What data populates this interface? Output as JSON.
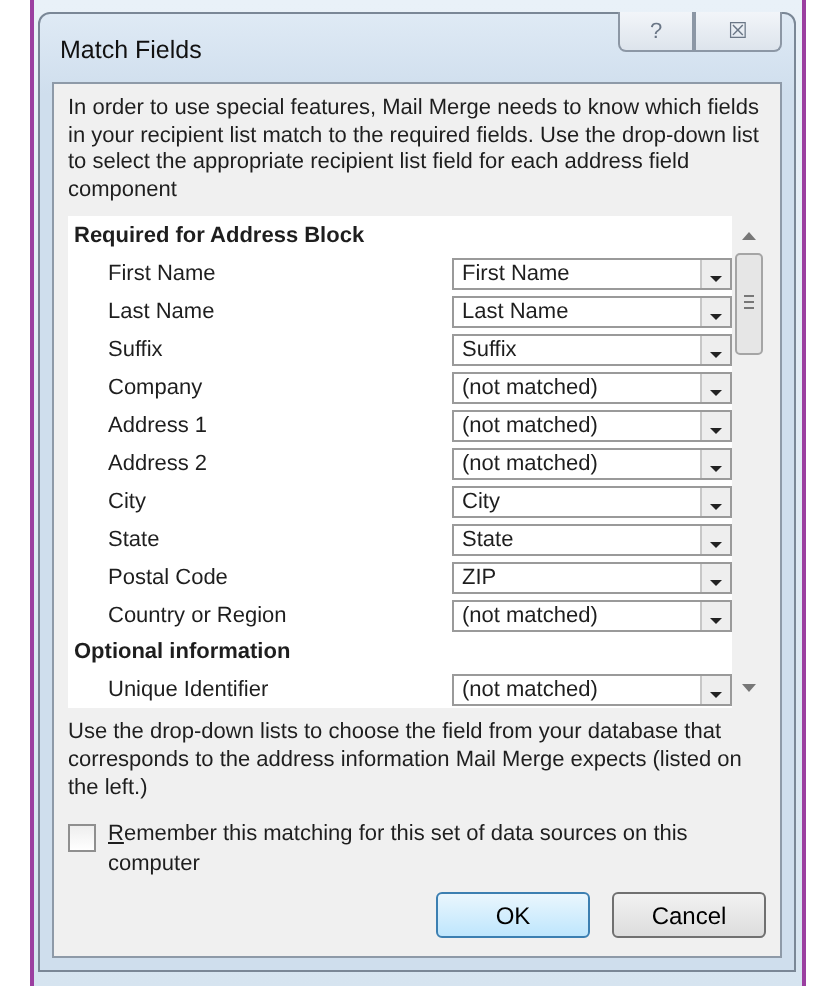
{
  "window": {
    "title": "Match Fields",
    "buttons": [
      "?",
      "☒"
    ]
  },
  "intro": "In order to use special features, Mail Merge needs to know which fields in your recipient list match to the required fields.  Use the drop-down list to select the appropriate recipient list field for each address field component",
  "groups": [
    {
      "heading": "Required for Address Block",
      "rows": [
        {
          "label": "First Name",
          "value": "First Name"
        },
        {
          "label": "Last Name",
          "value": "Last Name"
        },
        {
          "label": "Suffix",
          "value": "Suffix"
        },
        {
          "label": "Company",
          "value": "(not matched)"
        },
        {
          "label": "Address 1",
          "value": "(not matched)"
        },
        {
          "label": "Address 2",
          "value": "(not matched)"
        },
        {
          "label": "City",
          "value": "City"
        },
        {
          "label": "State",
          "value": "State"
        },
        {
          "label": "Postal Code",
          "value": "ZIP"
        },
        {
          "label": "Country or Region",
          "value": "(not matched)"
        }
      ]
    },
    {
      "heading": "Optional information",
      "rows": [
        {
          "label": "Unique Identifier",
          "value": "(not matched)"
        }
      ]
    }
  ],
  "help": "Use the drop-down lists to choose the field from your database that corresponds to the address information Mail Merge expects (listed on the left.)",
  "remember": {
    "label": "Remember this matching for this set of data sources on this computer",
    "checked": false
  },
  "buttons": [
    {
      "label": "OK",
      "default": true
    },
    {
      "label": "Cancel",
      "default": false
    }
  ]
}
